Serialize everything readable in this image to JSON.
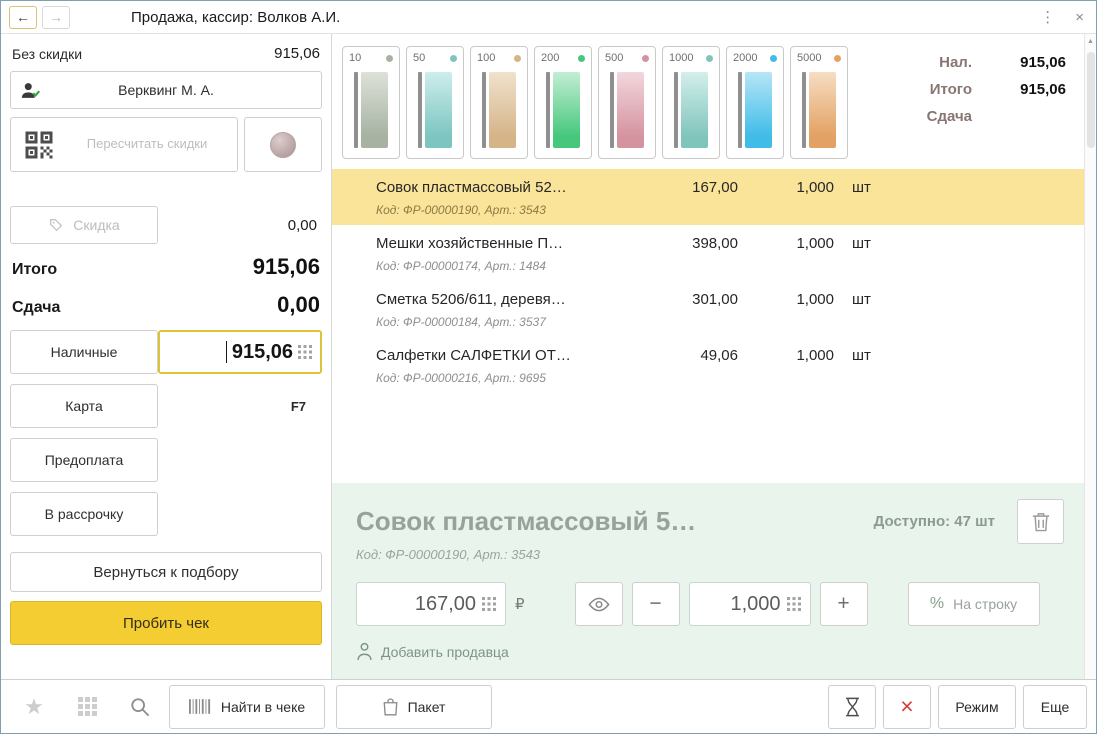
{
  "colors": {
    "accent_yellow": "#f3cd31",
    "selected_row": "#fae499",
    "detail_bg": "#e8f4ec",
    "danger_red": "#d63c32",
    "focus_border": "#dfc23c"
  },
  "icons": {
    "back": "←",
    "forward": "→",
    "menu": "⋮",
    "close": "×",
    "star": "★",
    "scroll_up": "▲",
    "cancel": "×"
  },
  "window": {
    "title": "Продажа, кассир: Волков А.И."
  },
  "sidebar": {
    "no_discount": {
      "label": "Без скидки",
      "value": "915,06"
    },
    "customer_button": "Верквинг М. А.",
    "recalc_button": "Пересчитать скидки",
    "discount_button": "Скидка",
    "discount_value": "0,00",
    "total": {
      "label": "Итого",
      "value": "915,06"
    },
    "change": {
      "label": "Сдача",
      "value": "0,00"
    },
    "cash_button": "Наличные",
    "cash_input_value": "915,06",
    "card_button": "Карта",
    "card_hotkey": "F7",
    "prepayment_button": "Предоплата",
    "installment_button": "В рассрочку",
    "return_button": "Вернуться к подбору",
    "checkout_button": "Пробить чек"
  },
  "denominations": [
    {
      "value": "10",
      "color": "#a7b2a2",
      "light": "#dde2d8"
    },
    {
      "value": "50",
      "color": "#7cc5c0",
      "light": "#cdeeec"
    },
    {
      "value": "100",
      "color": "#d5b488",
      "light": "#f0e2cc"
    },
    {
      "value": "200",
      "color": "#46c77c",
      "light": "#c2eed4"
    },
    {
      "value": "500",
      "color": "#d593a0",
      "light": "#f2d7dc"
    },
    {
      "value": "1000",
      "color": "#80c5bc",
      "light": "#d3efeb"
    },
    {
      "value": "2000",
      "color": "#3fbce7",
      "light": "#b6e6f7"
    },
    {
      "value": "5000",
      "color": "#e3a163",
      "light": "#f6ddc2"
    }
  ],
  "summary": {
    "rows": [
      {
        "label": "Нал.",
        "value": "915,06"
      },
      {
        "label": "Итого",
        "value": "915,06"
      },
      {
        "label": "Сдача",
        "value": ""
      }
    ]
  },
  "receipt": {
    "items": [
      {
        "name": "Совок пластмассовый 52…",
        "price": "167,00",
        "qty": "1,000",
        "unit": "шт",
        "code": "Код: ФР-00000190, Арт.: 3543",
        "selected": true
      },
      {
        "name": "Мешки хозяйственные П…",
        "price": "398,00",
        "qty": "1,000",
        "unit": "шт",
        "code": "Код: ФР-00000174, Арт.: 1484",
        "selected": false
      },
      {
        "name": "Сметка 5206/611, деревя…",
        "price": "301,00",
        "qty": "1,000",
        "unit": "шт",
        "code": "Код: ФР-00000184, Арт.: 3537",
        "selected": false
      },
      {
        "name": "Салфетки САЛФЕТКИ ОТ…",
        "price": "49,06",
        "qty": "1,000",
        "unit": "шт",
        "code": "Код: ФР-00000216, Арт.: 9695",
        "selected": false
      }
    ]
  },
  "detail": {
    "title": "Совок пластмассовый 5…",
    "code": "Код: ФР-00000190, Арт.: 3543",
    "available": "Доступно: 47 шт",
    "price_value": "167,00",
    "currency": "₽",
    "minus": "−",
    "qty_value": "1,000",
    "plus": "+",
    "percent": "%",
    "line_discount_button": "На строку",
    "add_seller": "Добавить продавца"
  },
  "toolbar": {
    "find_button": "Найти в чеке",
    "package_button": "Пакет",
    "mode_button": "Режим",
    "more_button": "Еще"
  }
}
